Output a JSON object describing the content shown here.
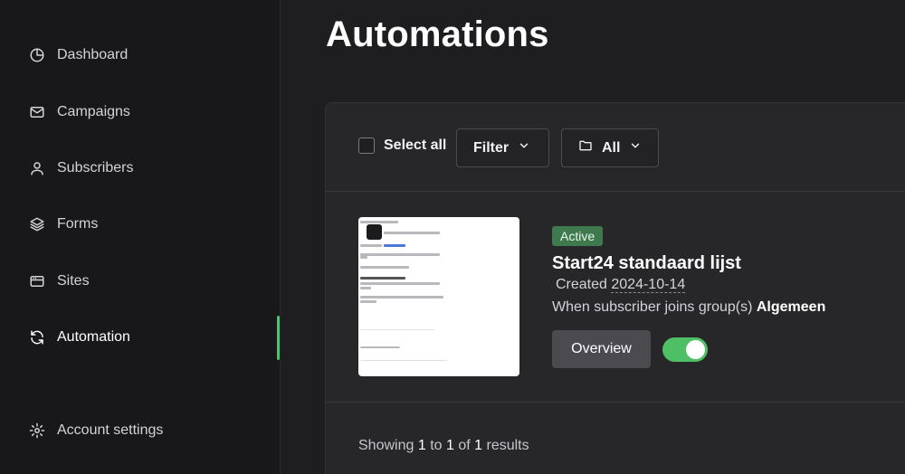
{
  "sidebar": {
    "items": [
      {
        "label": "Dashboard",
        "icon": "pie-chart-icon"
      },
      {
        "label": "Campaigns",
        "icon": "mail-icon"
      },
      {
        "label": "Subscribers",
        "icon": "user-icon"
      },
      {
        "label": "Forms",
        "icon": "layers-icon"
      },
      {
        "label": "Sites",
        "icon": "browser-icon"
      },
      {
        "label": "Automation",
        "icon": "refresh-icon",
        "active": true
      },
      {
        "label": "Account settings",
        "icon": "gear-icon"
      }
    ]
  },
  "page": {
    "title": "Automations"
  },
  "toolbar": {
    "select_all_label": "Select all",
    "filter_label": "Filter",
    "folder_label": "All"
  },
  "automations": [
    {
      "status": "Active",
      "name": "Start24 standaard lijst",
      "created_prefix": "Created",
      "created_date": "2024-10-14",
      "trigger_prefix": "When subscriber joins group(s)",
      "trigger_group": "Algemeen",
      "overview_label": "Overview",
      "enabled": true
    }
  ],
  "pagination": {
    "showing": "Showing",
    "from": "1",
    "to_word": "to",
    "to": "1",
    "of_word": "of",
    "total": "1",
    "results_word": "results"
  },
  "colors": {
    "accent": "#4fc36a",
    "badge_bg": "#3f7a4f",
    "toggle_on": "#4fbf66",
    "sidebar_bg": "#18181b",
    "page_bg": "#1e1e21",
    "panel_bg": "#27272a"
  }
}
